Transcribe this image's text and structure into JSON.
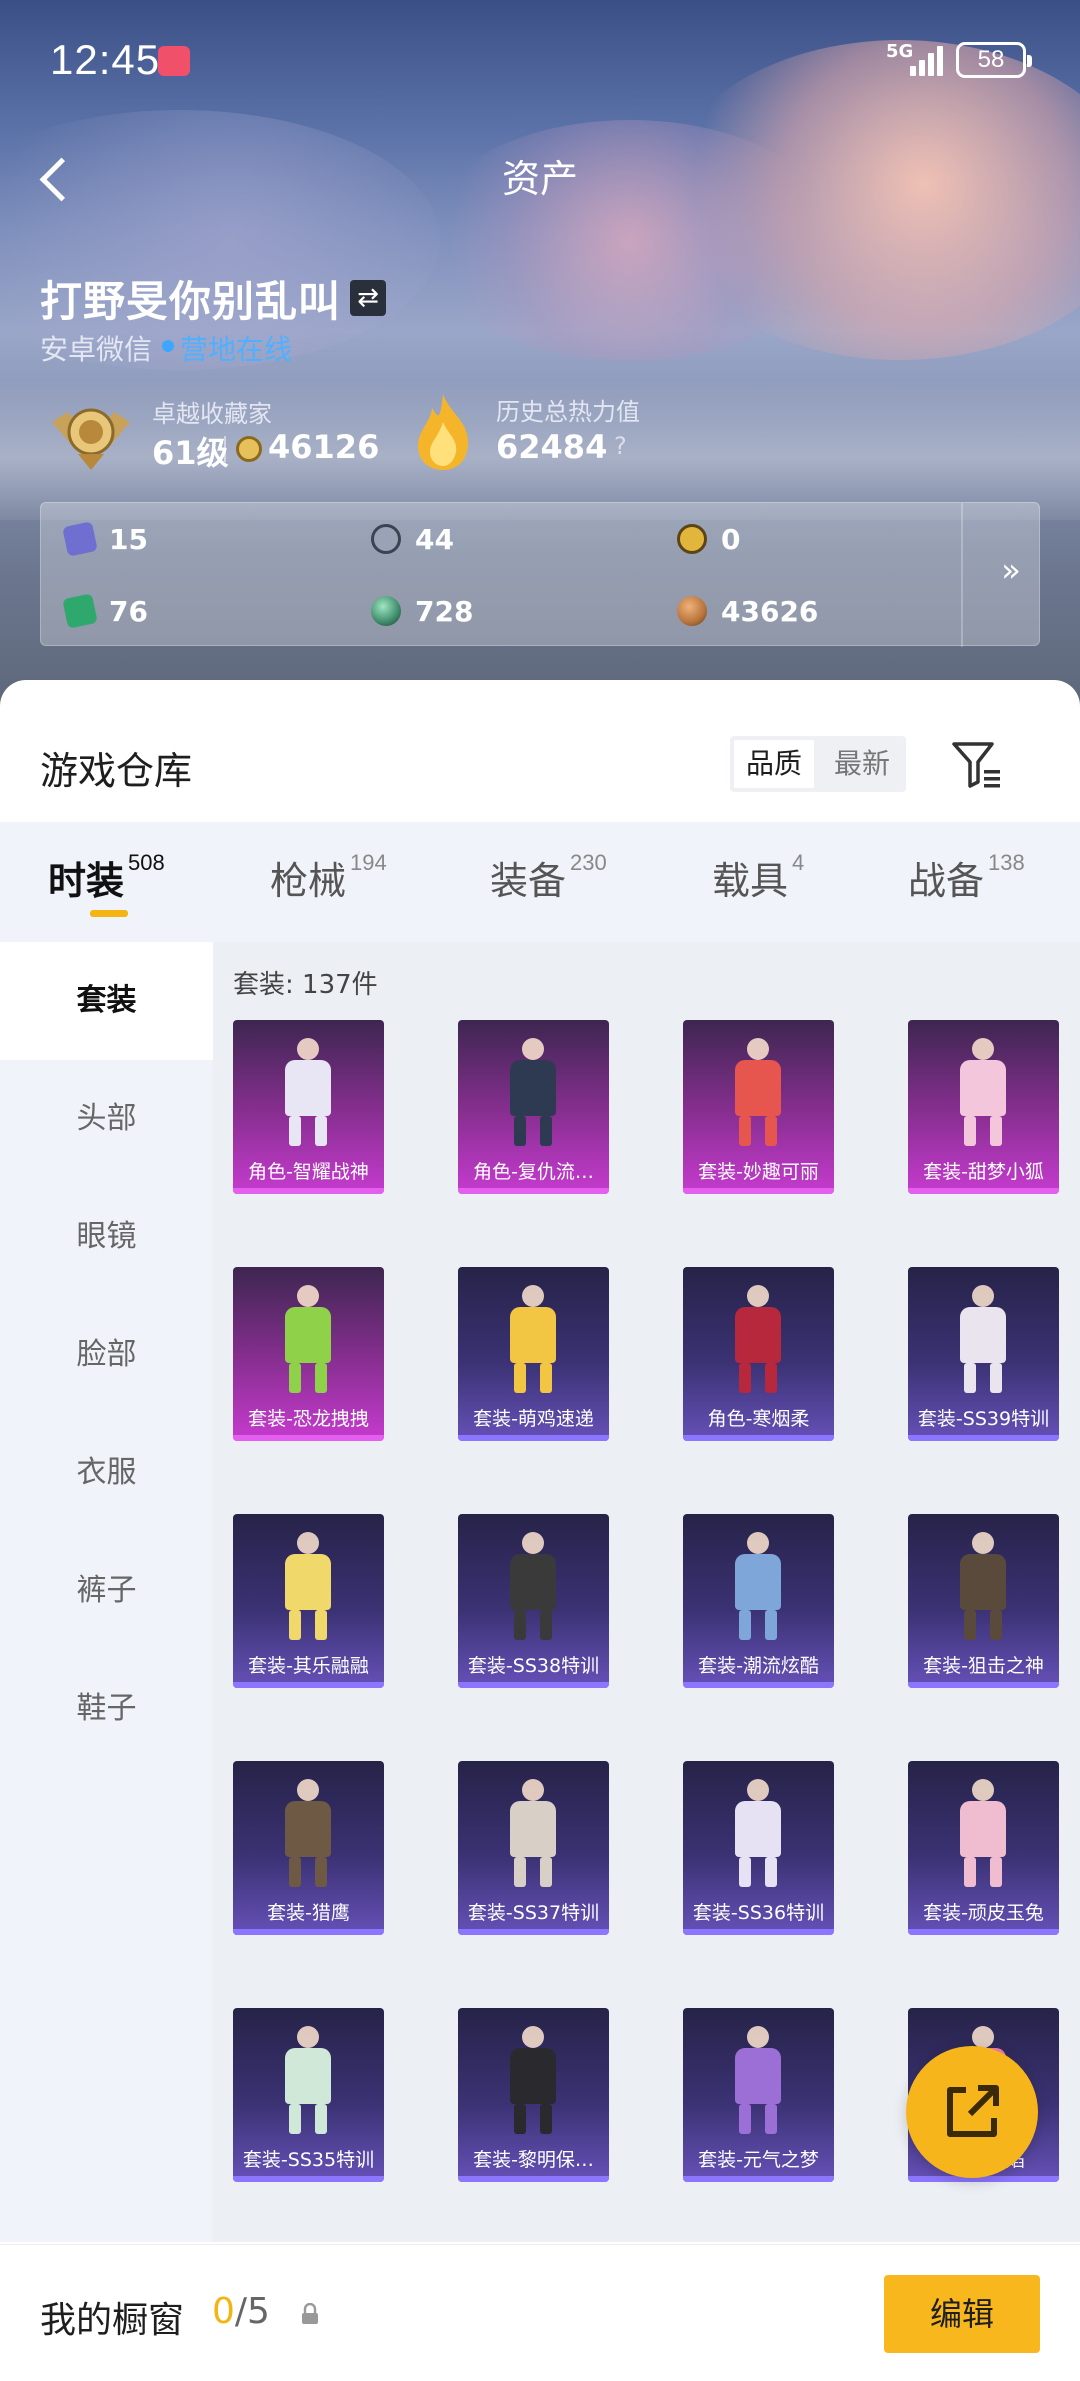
{
  "status_bar": {
    "time": "12:45",
    "network": "5G",
    "battery": "58"
  },
  "header": {
    "title": "资产"
  },
  "profile": {
    "name": "打野旻你别乱叫",
    "platform": "安卓微信",
    "online_status": "营地在线",
    "rank_title": "卓越收藏家",
    "level": "61级",
    "points": "46126",
    "heat_label": "历史总热力值",
    "heat_value": "62484",
    "help": "?"
  },
  "currencies": [
    {
      "icon": "purple-ticket-icon",
      "value": "15",
      "color": "#6e6fd0"
    },
    {
      "icon": "silver-coin-icon",
      "value": "44",
      "color": "#9aa3b5"
    },
    {
      "icon": "gold-coin-icon",
      "value": "0",
      "color": "#e2b63d"
    },
    {
      "icon": "green-ticket-icon",
      "value": "76",
      "color": "#2fa86e"
    },
    {
      "icon": "green-orb-icon",
      "value": "728",
      "color": "#3e8a6a"
    },
    {
      "icon": "bronze-coin-icon",
      "value": "43626",
      "color": "#b7743c"
    }
  ],
  "warehouse": {
    "title": "游戏仓库",
    "sort_options": [
      "品质",
      "最新"
    ],
    "active_sort": "品质"
  },
  "tabs": [
    {
      "label": "时装",
      "count": "508"
    },
    {
      "label": "枪械",
      "count": "194"
    },
    {
      "label": "装备",
      "count": "230"
    },
    {
      "label": "载具",
      "count": "4"
    },
    {
      "label": "战备",
      "count": "138"
    }
  ],
  "side_nav": [
    "套装",
    "头部",
    "眼镜",
    "脸部",
    "衣服",
    "裤子",
    "鞋子"
  ],
  "content": {
    "label": "套装: 137件",
    "items": [
      {
        "name": "角色-智耀战神",
        "rarity": "purple",
        "tone": "#e8e6f5"
      },
      {
        "name": "角色-复仇流…",
        "rarity": "purple",
        "tone": "#2d3a52"
      },
      {
        "name": "套装-妙趣可丽",
        "rarity": "purple",
        "tone": "#e7554f"
      },
      {
        "name": "套装-甜梦小狐",
        "rarity": "purple",
        "tone": "#f4c6dc"
      },
      {
        "name": "套装-恐龙拽拽",
        "rarity": "purple",
        "tone": "#8fd24a"
      },
      {
        "name": "套装-萌鸡速递",
        "rarity": "blue",
        "tone": "#f2c542"
      },
      {
        "name": "角色-寒烟柔",
        "rarity": "blue",
        "tone": "#b8283c"
      },
      {
        "name": "套装-SS39特训",
        "rarity": "blue",
        "tone": "#e9e4ee"
      },
      {
        "name": "套装-其乐融融",
        "rarity": "blue",
        "tone": "#f1d86a"
      },
      {
        "name": "套装-SS38特训",
        "rarity": "blue",
        "tone": "#3a3a3a"
      },
      {
        "name": "套装-潮流炫酷",
        "rarity": "blue",
        "tone": "#7fa6d8"
      },
      {
        "name": "套装-狙击之神",
        "rarity": "blue",
        "tone": "#5a4a3c"
      },
      {
        "name": "套装-猎鹰",
        "rarity": "blue",
        "tone": "#6e5a44"
      },
      {
        "name": "套装-SS37特训",
        "rarity": "blue",
        "tone": "#d8cfc6"
      },
      {
        "name": "套装-SS36特训",
        "rarity": "blue",
        "tone": "#e6e2f4"
      },
      {
        "name": "套装-顽皮玉兔",
        "rarity": "blue",
        "tone": "#f0bcd0"
      },
      {
        "name": "套装-SS35特训",
        "rarity": "blue",
        "tone": "#cfe8d8"
      },
      {
        "name": "套装-黎明保…",
        "rarity": "blue",
        "tone": "#2a2a2e"
      },
      {
        "name": "套装-元气之梦",
        "rarity": "blue",
        "tone": "#9b6fd6"
      },
      {
        "name": "套装-…焰",
        "rarity": "blue",
        "tone": "#f07aa8"
      }
    ]
  },
  "showcase": {
    "label": "我的橱窗",
    "current": "0",
    "total": "/5",
    "edit_label": "编辑"
  }
}
